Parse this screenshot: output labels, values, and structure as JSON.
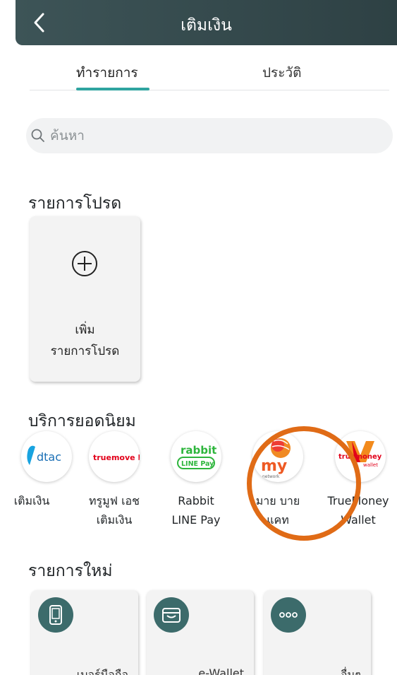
{
  "header": {
    "title": "เติมเงิน",
    "back_icon": "chevron-left-icon"
  },
  "tabs": [
    {
      "label": "ทำรายการ",
      "active": true
    },
    {
      "label": "ประวัติ",
      "active": false
    }
  ],
  "search": {
    "placeholder": "ค้นหา",
    "value": ""
  },
  "favorites": {
    "title": "รายการโปรด",
    "add_label_line1": "เพิ่ม",
    "add_label_line2": "รายการโปรด"
  },
  "popular": {
    "title": "บริการยอดนิยม",
    "items": [
      {
        "logo_text": "dtac",
        "line1": "เติมเงิน",
        "line2": ""
      },
      {
        "logo_text": "truemove H",
        "line1": "ทรูมูฟ เอช",
        "line2": "เติมเงิน"
      },
      {
        "logo_text": "rabbit",
        "logo_sub": "LINE Pay",
        "line1": "Rabbit",
        "line2": "LINE Pay"
      },
      {
        "logo_text": "my",
        "logo_sub": "network",
        "line1": "มาย บาย",
        "line2": "แคท"
      },
      {
        "logo_text": "truemoney",
        "logo_sub": "wallet",
        "line1": "TrueMoney",
        "line2": "Wallet"
      }
    ]
  },
  "new_items": {
    "title": "รายการใหม่",
    "items": [
      {
        "icon": "mobile-phone-icon",
        "label": "เบอร์มือถือ"
      },
      {
        "icon": "wallet-icon",
        "label": "e-Wallet"
      },
      {
        "icon": "more-icon",
        "label": "อื่นๆ"
      }
    ]
  },
  "colors": {
    "header": "#3d5457",
    "accent": "#2fa4a0",
    "highlight_circle": "#e06b16",
    "icon_bg": "#3c6b6b"
  }
}
